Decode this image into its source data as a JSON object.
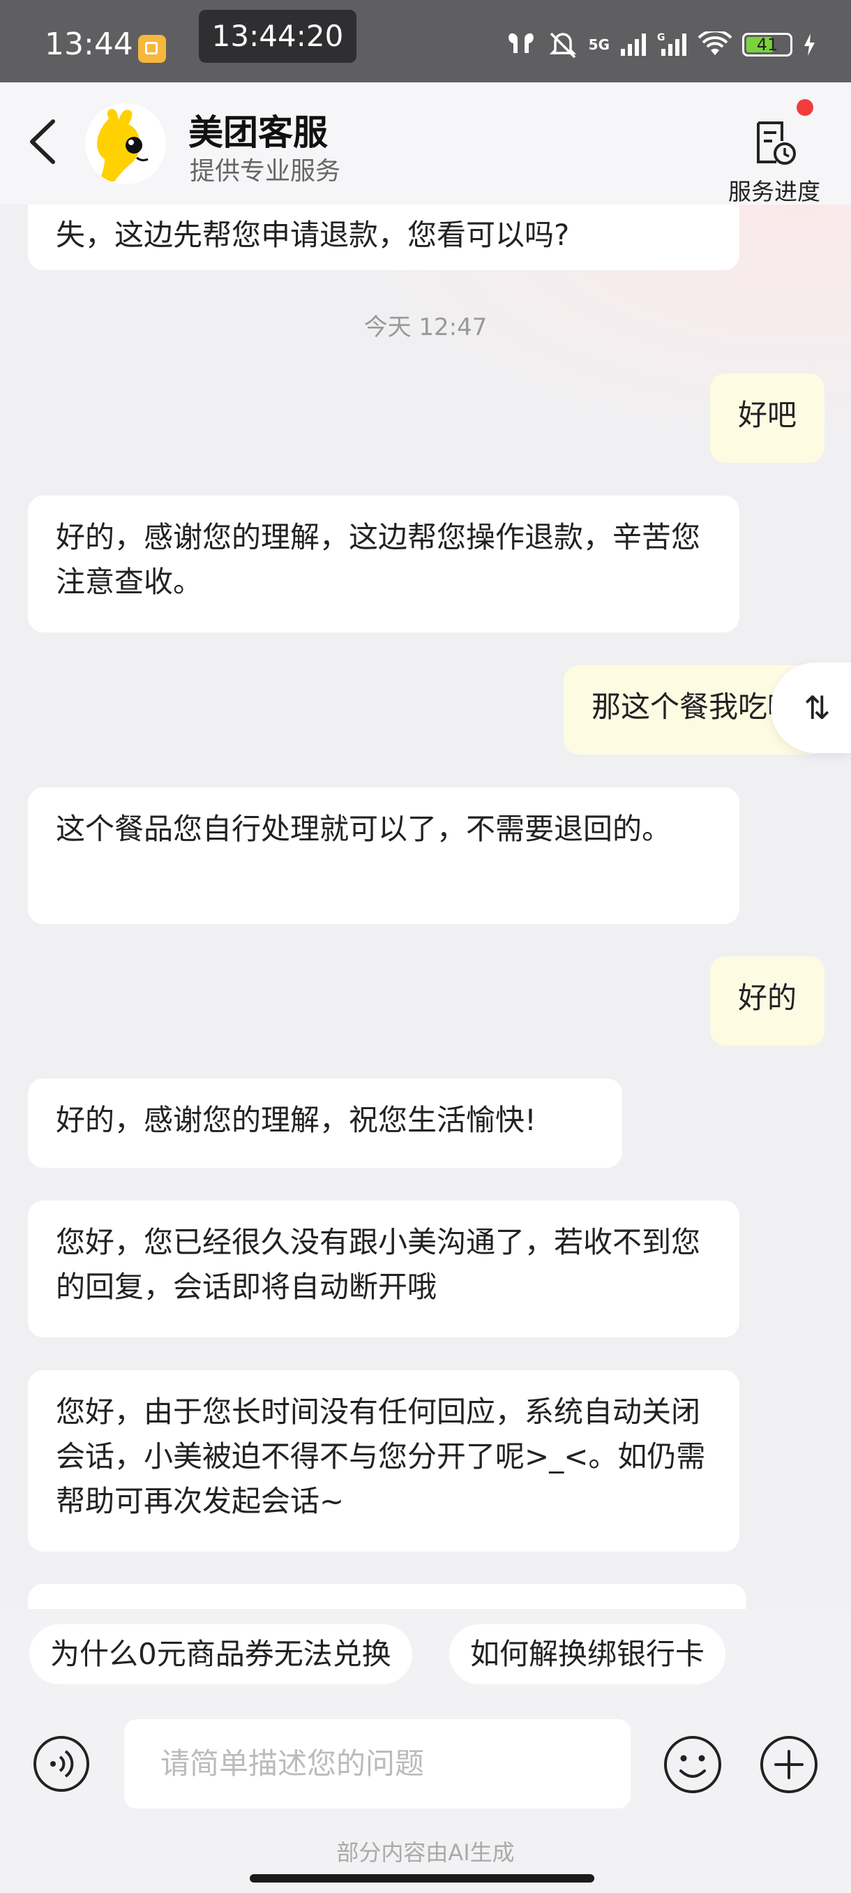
{
  "status_bar": {
    "time": "13:44",
    "overlay_time": "13:44:20",
    "network": "5G",
    "battery": "41"
  },
  "header": {
    "title": "美团客服",
    "subtitle": "提供专业服务",
    "progress_label": "服务进度"
  },
  "messages": [
    {
      "from": "agent",
      "text": "失，这边先帮您申请退款，您看可以吗?"
    },
    {
      "type": "timestamp",
      "text": "今天 12:47"
    },
    {
      "from": "user",
      "text": "好吧"
    },
    {
      "from": "agent",
      "text": "好的，感谢您的理解，这边帮您操作退款，辛苦您注意查收。"
    },
    {
      "from": "user",
      "text": "那这个餐我吃啦"
    },
    {
      "from": "agent",
      "text": "这个餐品您自行处理就可以了，不需要退回的。"
    },
    {
      "from": "user",
      "text": "好的"
    },
    {
      "from": "agent",
      "text": "好的，感谢您的理解，祝您生活愉快!"
    },
    {
      "from": "agent",
      "text": "您好，您已经很久没有跟小美沟通了，若收不到您的回复，会话即将自动断开哦"
    },
    {
      "from": "agent",
      "text": "您好，由于您长时间没有任何回应，系统自动关闭会话，小美被迫不得不与您分开了呢>_<。如仍需帮助可再次发起会话~"
    }
  ],
  "scroll_button": "⇅",
  "quick_questions": [
    "为什么0元商品券无法兑换",
    "如何解换绑银行卡"
  ],
  "input": {
    "placeholder": "请简单描述您的问题"
  },
  "footer_note": "部分内容由AI生成"
}
